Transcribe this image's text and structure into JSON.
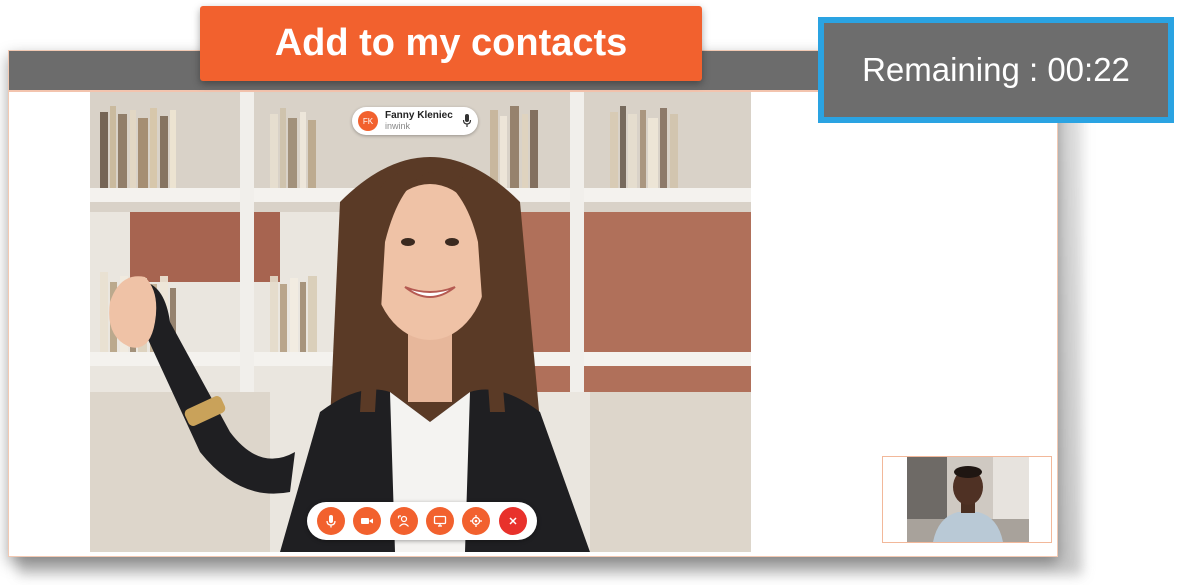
{
  "window": {
    "add_contact_label": "Add to my contacts",
    "remaining_text": "Remaining : 00:22"
  },
  "participant": {
    "initials": "FK",
    "name": "Fanny Kleniec",
    "company": "inwink"
  },
  "controls": [
    {
      "name": "microphone",
      "icon": "mic-icon"
    },
    {
      "name": "camera",
      "icon": "video-camera-icon"
    },
    {
      "name": "virtual-background",
      "icon": "background-effect-icon"
    },
    {
      "name": "screen-share",
      "icon": "monitor-icon"
    },
    {
      "name": "settings",
      "icon": "gear-icon"
    },
    {
      "name": "end-call",
      "icon": "close-icon"
    }
  ],
  "colors": {
    "accent": "#f2612e",
    "end_call": "#e8312b",
    "timer_border": "#2aa3e2",
    "title_bar": "#6c6c6c"
  }
}
